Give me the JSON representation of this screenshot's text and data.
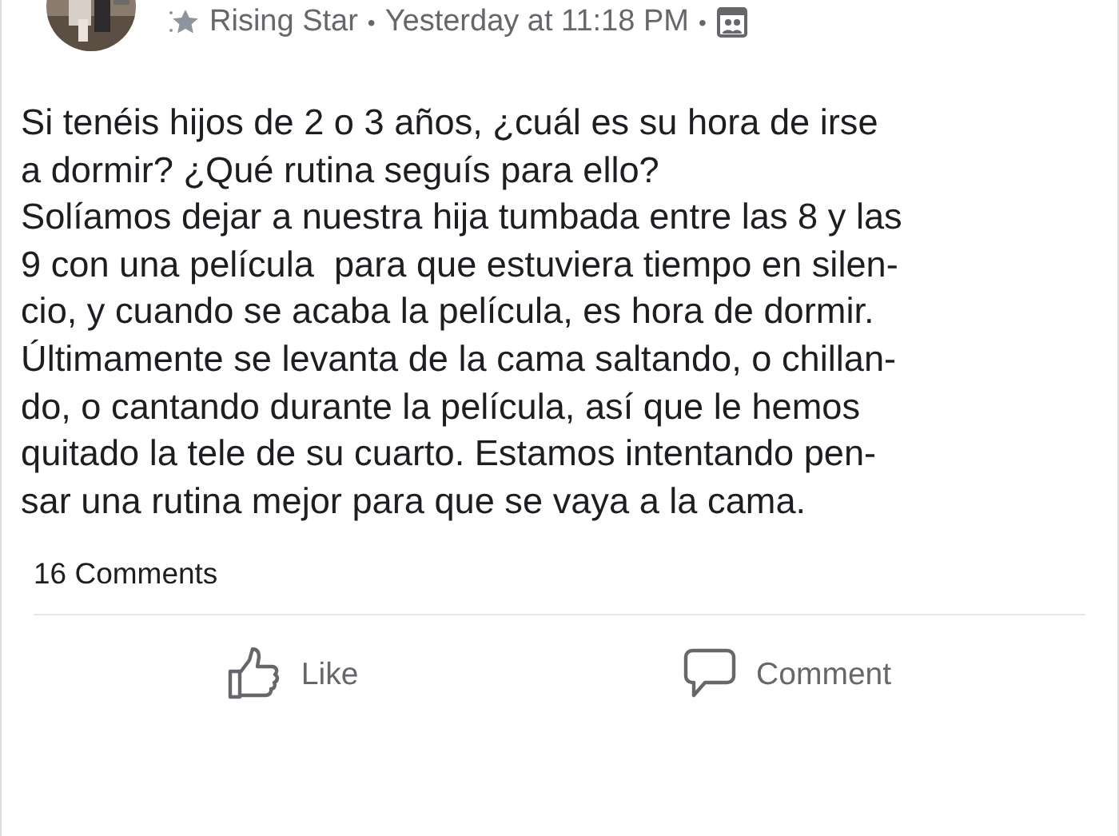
{
  "post": {
    "badge": "Rising Star",
    "separator_1": "•",
    "time": "Yesterday at 11:18 PM",
    "separator_2": "•",
    "question": "Si tenéis hijos de 2 o 3 años, ¿cuál es su hora de irse\na dormir? ¿Qué rutina seguís para ello?",
    "body": "Solíamos dejar a nuestra hija tumbada entre las 8 y las\n9 con una película  para que estuviera tiempo en silen-\ncio, y cuando se acaba la película, es hora de dormir.\nÚltimamente se levanta de la cama saltando, o chillan-\ndo, o cantando durante la película, así que le hemos\nquitado la tele de su cuarto. Estamos intentando pen-\nsar una rutina mejor para que se vaya a la cama."
  },
  "comments_count": "16 Comments",
  "actions": [
    {
      "kind": "like",
      "label": "Like"
    },
    {
      "kind": "comment",
      "label": "Comment"
    }
  ]
}
